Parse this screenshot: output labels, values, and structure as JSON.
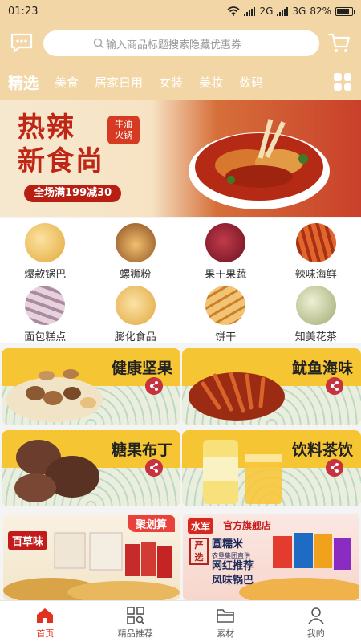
{
  "status_bar": {
    "time": "01:23",
    "network_1": "2G",
    "network_2": "3G",
    "battery": "82%",
    "battery_level": 0.82
  },
  "header": {
    "search_placeholder": "输入商品标题搜索隐藏优惠券"
  },
  "tabs": [
    {
      "label": "精选",
      "active": true
    },
    {
      "label": "美食"
    },
    {
      "label": "居家日用"
    },
    {
      "label": "女装"
    },
    {
      "label": "美妆"
    },
    {
      "label": "数码"
    }
  ],
  "banner": {
    "title_line1": "热辣",
    "title_line2": "新食尚",
    "badge_line1": "牛油",
    "badge_line2": "火锅",
    "promo": "全场满199减30"
  },
  "categories": [
    {
      "label": "爆款锅巴",
      "color": "#f2c04f"
    },
    {
      "label": "螺狮粉",
      "color": "#d99a3c"
    },
    {
      "label": "果干果蔬",
      "color": "#8c1d2b"
    },
    {
      "label": "辣味海鲜",
      "color": "#c8461d"
    },
    {
      "label": "面包糕点",
      "color": "#b79bb0"
    },
    {
      "label": "膨化食品",
      "color": "#f1c45d"
    },
    {
      "label": "饼干",
      "color": "#e6a64a"
    },
    {
      "label": "知美花茶",
      "color": "#c9cf9c"
    }
  ],
  "promos": [
    {
      "title": "健康坚果",
      "food_color": "#b27a4a"
    },
    {
      "title": "鱿鱼海味",
      "food_color": "#a8321c"
    },
    {
      "title": "糖果布丁",
      "food_color": "#6a3d2c"
    },
    {
      "title": "饮料茶饮",
      "food_color": "#f8c63b"
    }
  ],
  "shops": [
    {
      "brand": "百草味",
      "tag": "聚划算"
    },
    {
      "brand": "水军",
      "store": "官方旗舰店",
      "stamp": "严选",
      "line1": "圆糯米",
      "line1_sub": "农垦集团直供",
      "line2": "网红推荐",
      "line3": "风味锅巴"
    }
  ],
  "bottom_nav": [
    {
      "label": "首页",
      "active": true
    },
    {
      "label": "精品推荐"
    },
    {
      "label": "素材"
    },
    {
      "label": "我的"
    }
  ],
  "colors": {
    "header_bg": "#f3d6a6",
    "accent_red": "#e0321f",
    "promo_yellow": "#f6c533"
  }
}
